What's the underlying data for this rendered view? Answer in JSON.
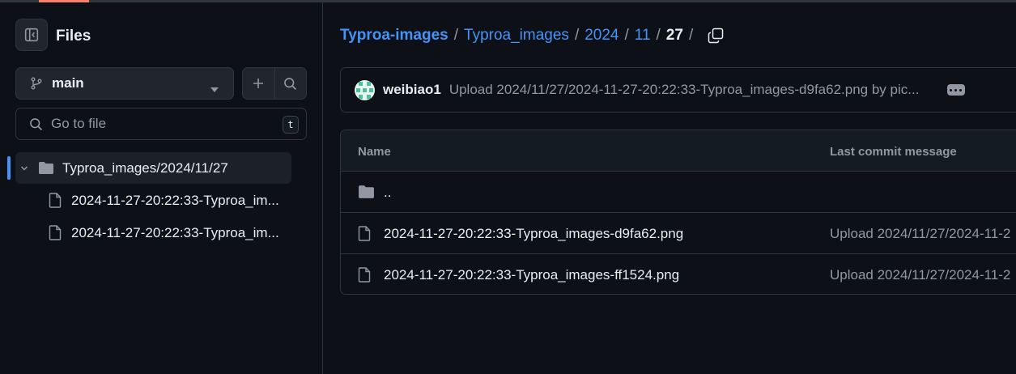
{
  "sidebar": {
    "title": "Files",
    "branch": "main",
    "goto_placeholder": "Go to file",
    "shortcut_key": "t",
    "tree": [
      {
        "label": "Typroa_images/2024/11/27",
        "type": "folder"
      },
      {
        "label": "2024-11-27-20:22:33-Typroa_im...",
        "type": "file"
      },
      {
        "label": "2024-11-27-20:22:33-Typroa_im...",
        "type": "file"
      }
    ]
  },
  "breadcrumb": {
    "repo": "Typroa-images",
    "parts": [
      "Typroa_images",
      "2024",
      "11"
    ],
    "current": "27",
    "separator": "/"
  },
  "commit": {
    "author": "weibiao1",
    "message": "Upload 2024/11/27/2024-11-27-20:22:33-Typroa_images-d9fa62.png by pic..."
  },
  "table": {
    "headers": [
      "Name",
      "Last commit message"
    ],
    "parent_dir": "..",
    "rows": [
      {
        "name": "2024-11-27-20:22:33-Typroa_images-d9fa62.png",
        "commit": "Upload 2024/11/27/2024-11-2"
      },
      {
        "name": "2024-11-27-20:22:33-Typroa_images-ff1524.png",
        "commit": "Upload 2024/11/27/2024-11-2"
      }
    ]
  },
  "colors": {
    "background": "#0d1117",
    "border": "#30363d",
    "link": "#4493f8",
    "muted": "#9198a1",
    "accent": "#f78166"
  }
}
